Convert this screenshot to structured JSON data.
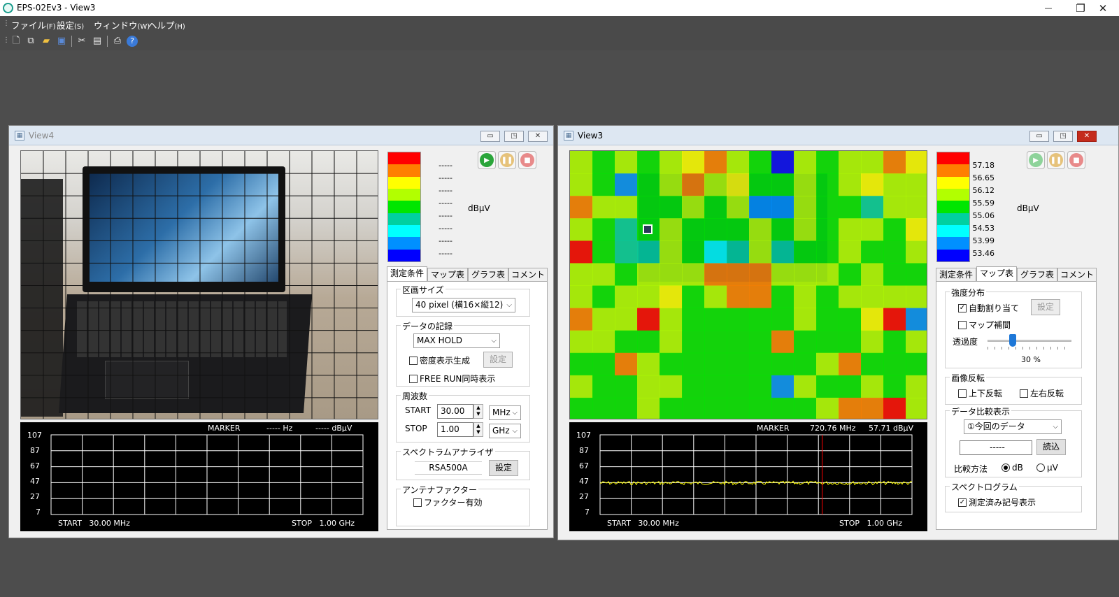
{
  "app": {
    "title": "EPS-02Ev3 - View3"
  },
  "window_controls": {
    "minimize": "—",
    "maximize": "❐",
    "close": "✕"
  },
  "menu": [
    {
      "label": "ファイル",
      "key": "(F)"
    },
    {
      "label": "設定",
      "key": "(S)"
    },
    {
      "label": "ウィンドウ",
      "key": "(W)"
    },
    {
      "label": "ヘルプ",
      "key": "(H)"
    }
  ],
  "toolbar": {
    "icons": [
      "new-file-icon",
      "copy-icon",
      "open-folder-icon",
      "save-icon",
      "cut-icon",
      "paste-icon",
      "print-icon",
      "help-icon"
    ]
  },
  "view4": {
    "title": "View4",
    "legend": {
      "values": [
        "-----",
        "-----",
        "-----",
        "-----",
        "-----",
        "-----",
        "-----",
        "-----"
      ],
      "unit": "dBμV"
    },
    "tabs": [
      "測定条件",
      "マップ表示",
      "グラフ表示",
      "コメント"
    ],
    "active_tab": 0,
    "section_size": {
      "label": "区画サイズ",
      "value": "40 pixel (横16×縦12)"
    },
    "record": {
      "label": "データの記録",
      "value": "MAX HOLD",
      "density_label": "密度表示生成",
      "density_checked": false,
      "set_label": "設定",
      "freerun_label": "FREE RUN同時表示",
      "freerun_checked": false
    },
    "frequency": {
      "label": "周波数",
      "start_label": "START",
      "start_value": "30.00",
      "start_unit": "MHz",
      "stop_label": "STOP",
      "stop_value": "1.00",
      "stop_unit": "GHz"
    },
    "analyzer": {
      "label": "スペクトラムアナライザ",
      "value": "RSA500A",
      "set_label": "設定"
    },
    "antenna": {
      "label": "アンテナファクター",
      "factor_label": "ファクター有効",
      "factor_checked": false
    },
    "graph": {
      "marker_label": "MARKER",
      "marker_freq": "----- Hz",
      "marker_level": "----- dBμV",
      "y_ticks": [
        "107",
        "87",
        "67",
        "47",
        "27",
        "7"
      ],
      "start": "START   30.00 MHz",
      "stop": "STOP   1.00 GHz"
    }
  },
  "view3": {
    "title": "View3",
    "legend": {
      "values": [
        "57.18",
        "56.65",
        "56.12",
        "55.59",
        "55.06",
        "54.53",
        "53.99",
        "53.46"
      ],
      "unit": "dBμV"
    },
    "tabs": [
      "測定条件",
      "マップ表示",
      "グラフ表示",
      "コメント"
    ],
    "active_tab": 1,
    "intensity": {
      "label": "強度分布",
      "auto_label": "自動割り当て",
      "auto_checked": true,
      "set_label": "設定",
      "interp_label": "マップ補間",
      "interp_checked": false,
      "transparency_label": "透過度",
      "transparency_value": "30 %",
      "transparency_fraction": 0.3
    },
    "flip": {
      "label": "画像反転",
      "vertical_label": "上下反転",
      "vertical_checked": false,
      "horizontal_label": "左右反転",
      "horizontal_checked": false
    },
    "compare": {
      "label": "データ比較表示",
      "value": "①今回のデータ",
      "file_value": "-----",
      "load_label": "読込",
      "method_label": "比較方法",
      "db_label": "dB",
      "uv_label": "μV",
      "selected": "dB"
    },
    "spectrogram": {
      "label": "スペクトログラム",
      "marker_label": "測定済み記号表示",
      "marker_checked": true
    },
    "graph": {
      "marker_label": "MARKER",
      "marker_freq": "720.76 MHz",
      "marker_level": "57.71 dBμV",
      "y_ticks": [
        "107",
        "87",
        "67",
        "47",
        "27",
        "7"
      ],
      "start": "START   30.00 MHz",
      "stop": "STOP   1.00 GHz"
    }
  },
  "colors": {
    "scale": [
      "#ff0000",
      "#ff7f00",
      "#ffff00",
      "#b2ff00",
      "#00e600",
      "#00d0a0",
      "#00ffff",
      "#0090ff",
      "#0000ff"
    ],
    "trace": "#ffff00",
    "marker_line": "#ff0000"
  },
  "heatmap": {
    "cols": 16,
    "rows": 12,
    "levels": [
      [
        3,
        4,
        3,
        4,
        3,
        2,
        1,
        3,
        4,
        8,
        3,
        4,
        3,
        3,
        1,
        2
      ],
      [
        3,
        4,
        7,
        4,
        3,
        1,
        3,
        2,
        4,
        4,
        3,
        4,
        3,
        2,
        3,
        3
      ],
      [
        1,
        3,
        3,
        4,
        4,
        3,
        4,
        3,
        7,
        7,
        3,
        4,
        4,
        5,
        3,
        3
      ],
      [
        3,
        4,
        5,
        4,
        3,
        4,
        4,
        4,
        3,
        4,
        3,
        4,
        3,
        3,
        4,
        2
      ],
      [
        0,
        4,
        5,
        5,
        3,
        4,
        6,
        5,
        3,
        5,
        4,
        4,
        3,
        4,
        4,
        3
      ],
      [
        3,
        3,
        4,
        3,
        3,
        3,
        1,
        1,
        1,
        3,
        3,
        3,
        4,
        3,
        4,
        4
      ],
      [
        3,
        4,
        3,
        3,
        2,
        4,
        3,
        1,
        1,
        4,
        3,
        4,
        3,
        3,
        3,
        3
      ],
      [
        1,
        3,
        3,
        0,
        3,
        4,
        4,
        4,
        4,
        4,
        3,
        4,
        4,
        2,
        0,
        7
      ],
      [
        3,
        3,
        4,
        4,
        3,
        4,
        4,
        4,
        4,
        1,
        4,
        4,
        4,
        3,
        4,
        3
      ],
      [
        4,
        4,
        1,
        3,
        4,
        4,
        4,
        4,
        4,
        4,
        4,
        3,
        1,
        4,
        4,
        4
      ],
      [
        3,
        4,
        4,
        3,
        3,
        4,
        4,
        4,
        4,
        7,
        3,
        4,
        4,
        3,
        4,
        3
      ],
      [
        4,
        4,
        4,
        3,
        4,
        4,
        4,
        4,
        4,
        4,
        4,
        3,
        1,
        1,
        0,
        3
      ]
    ]
  }
}
